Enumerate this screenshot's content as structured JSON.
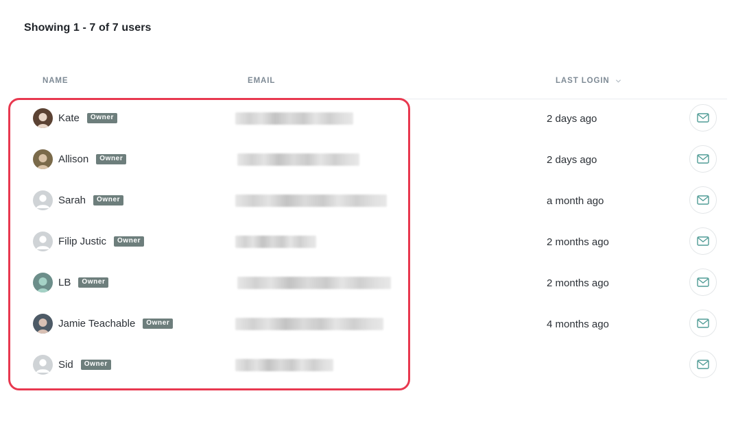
{
  "summary": "Showing 1 - 7 of 7 users",
  "columns": {
    "name": "NAME",
    "email": "EMAIL",
    "last_login": "LAST LOGIN"
  },
  "icons": {
    "sort": "chevron-down-icon",
    "mail": "envelope-icon",
    "avatar_placeholder": "user-avatar-icon"
  },
  "colors": {
    "highlight": "#e8384f",
    "badge": "#6d7e7c",
    "mail_icon": "#4f9b95"
  },
  "users": [
    {
      "name": "Kate",
      "role": "Owner",
      "last_login": "2 days ago",
      "avatar": "photo"
    },
    {
      "name": "Allison",
      "role": "Owner",
      "last_login": "2 days ago",
      "avatar": "photo"
    },
    {
      "name": "Sarah",
      "role": "Owner",
      "last_login": "a month ago",
      "avatar": "placeholder"
    },
    {
      "name": "Filip Justic",
      "role": "Owner",
      "last_login": "2 months ago",
      "avatar": "placeholder"
    },
    {
      "name": "LB",
      "role": "Owner",
      "last_login": "2 months ago",
      "avatar": "photo"
    },
    {
      "name": "Jamie Teachable",
      "role": "Owner",
      "last_login": "4 months ago",
      "avatar": "photo"
    },
    {
      "name": "Sid",
      "role": "Owner",
      "last_login": "",
      "avatar": "placeholder"
    }
  ]
}
